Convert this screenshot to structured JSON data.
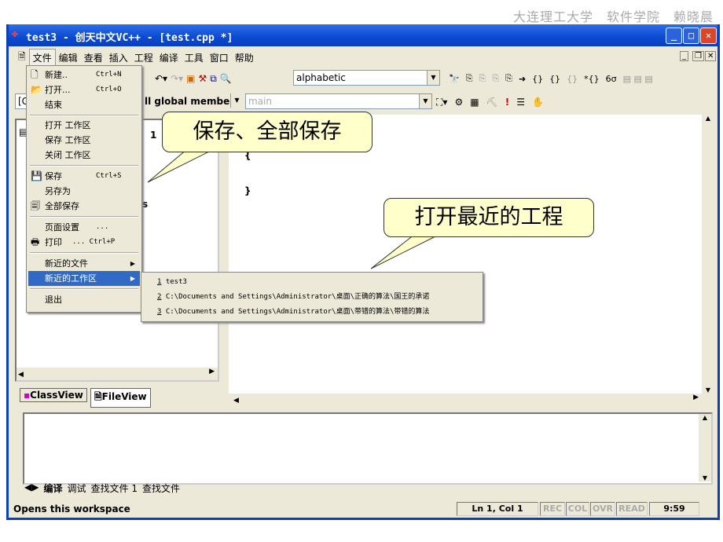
{
  "credit": "大连理工大学　软件学院　赖晓晨",
  "window": {
    "title": "test3 - 创天中文VC++ - [test.cpp *]"
  },
  "menubar": [
    "文件",
    "编辑",
    "查看",
    "插入",
    "工程",
    "编译",
    "工具",
    "窗口",
    "帮助"
  ],
  "toolbar": {
    "find_combo": "alphabetic",
    "scope_combo": "ll global members",
    "function_combo": "main",
    "class_combo_partial": "[G"
  },
  "file_menu": {
    "items": [
      {
        "label": "新建..",
        "shortcut": "Ctrl+N",
        "icon": "new-file-icon"
      },
      {
        "label": "打开...",
        "shortcut": "Ctrl+O",
        "icon": "open-folder-icon"
      },
      {
        "label": "结束"
      },
      {
        "label": "打开 工作区"
      },
      {
        "label": "保存 工作区"
      },
      {
        "label": "关闭 工作区"
      },
      {
        "label": "保存",
        "shortcut": "Ctrl+S",
        "icon": "save-icon"
      },
      {
        "label": "另存为"
      },
      {
        "label": "全部保存",
        "icon": "save-all-icon"
      },
      {
        "label": "页面设置",
        "shortcut": "..."
      },
      {
        "label": "打印",
        "shortcut": "...    Ctrl+P",
        "icon": "print-icon"
      },
      {
        "label": "新近的文件"
      },
      {
        "label": "新近的工作区"
      },
      {
        "label": "退出"
      }
    ]
  },
  "recent_workspaces": [
    {
      "num": "1",
      "path": "test3"
    },
    {
      "num": "2",
      "path": "C:\\Documents and Settings\\Administrator\\桌面\\正确的算法\\国王的承诺"
    },
    {
      "num": "3",
      "path": "C:\\Documents and Settings\\Administrator\\桌面\\带错的算法\\带错的算法"
    }
  ],
  "callouts": {
    "save": "保存、全部保存",
    "recent": "打开最近的工程"
  },
  "workspace": {
    "partial_1": "1",
    "partial_s": "s",
    "tabs": [
      "ClassView",
      "FileView"
    ]
  },
  "editor": {
    "lines": [
      "{",
      "}"
    ]
  },
  "output": {
    "tabs": [
      "编译",
      "调试",
      "查找文件 1",
      "查找文件"
    ]
  },
  "status": {
    "message": "Opens this workspace",
    "position": "Ln 1, Col 1",
    "indicators": [
      "REC",
      "COL",
      "OVR",
      "READ"
    ],
    "time": "9:59"
  },
  "colors": {
    "title_bar": "#0a4ad0",
    "highlight": "#316ac5",
    "callout": "#ffffcc"
  }
}
